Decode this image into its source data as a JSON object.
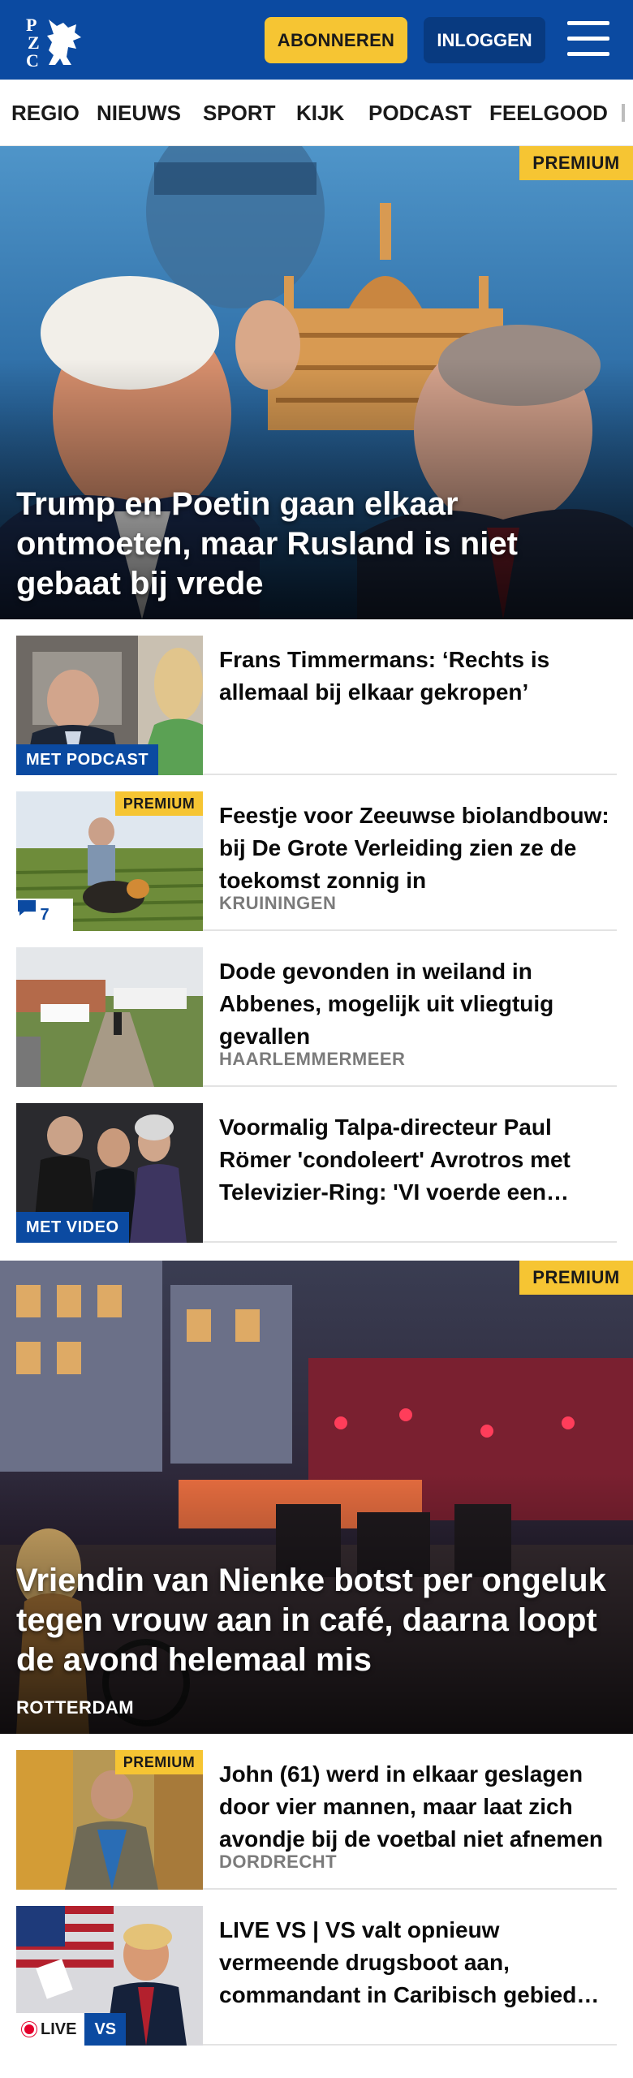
{
  "header": {
    "logo_text": "PZC",
    "subscribe_label": "ABONNEREN",
    "login_label": "INLOGGEN",
    "menu_icon": "hamburger-menu-icon",
    "brand_color": "#0b4aa1",
    "accent_color": "#f6c533"
  },
  "nav": {
    "items": [
      "REGIO",
      "NIEUWS",
      "SPORT",
      "KIJK",
      "PODCAST",
      "FEELGOOD"
    ]
  },
  "hero": {
    "badge": "PREMIUM",
    "title": "Trump en Poetin gaan elkaar ontmoeten, maar Rusland is niet gebaat bij vrede"
  },
  "articles": [
    {
      "title": "Frans Timmermans: ‘Rechts is allemaal bij elkaar gekropen’",
      "label": "MET PODCAST"
    },
    {
      "title": "Feestje voor Zeeuwse bioland­bouw: bij De Grote Verleiding zien ze de toekomst zonnig in",
      "badge": "PREMIUM",
      "comments": "7",
      "location": "KRUININGEN"
    },
    {
      "title": "Dode gevonden in weiland in Abbenes, mogelijk uit vliegtuig gevallen",
      "location": "HAARLEMMERMEER"
    },
    {
      "title": "Voormalig Talpa-directeur Paul Römer 'condoleert' Avrotros met Televizier-Ring: 'VI voerde een eerlijk gevecht'",
      "label": "MET VIDEO"
    }
  ],
  "feature": {
    "badge": "PREMIUM",
    "title": "Vriendin van Nienke botst per ongeluk tegen vrouw aan in café, daarna loopt de avond helemaal mis",
    "location": "ROTTERDAM"
  },
  "articles2": [
    {
      "title": "John (61) werd in elkaar geslagen door vier mannen, maar laat zich avondje bij de voetbal niet afnemen",
      "badge": "PREMIUM",
      "location": "DORDRECHT"
    },
    {
      "title": "LIVE VS | VS valt opnieuw vermeende drugsboot aan, commandant in Caribisch gebied stapt op",
      "live_label": "LIVE",
      "live_tag": "VS"
    }
  ]
}
